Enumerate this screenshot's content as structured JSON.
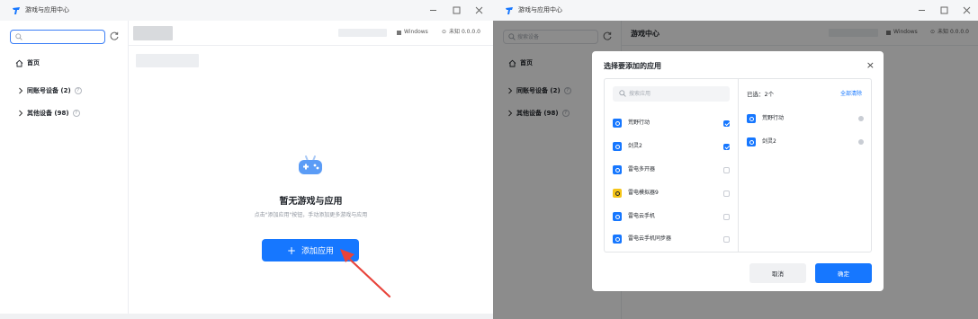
{
  "colors": {
    "accent": "#1677ff",
    "checkbox_checked": "#1677ff",
    "mask": "rgba(0,0,0,0.45)"
  },
  "window1": {
    "app_title": "游戏与应用中心",
    "search_placeholder": "",
    "nav": {
      "home": "首页",
      "same_account": "同账号设备 (2)",
      "other_devices": "其他设备 (98)"
    },
    "platform": "Windows",
    "location_version": "未知 0.0.0.0",
    "empty": {
      "title": "暂无游戏与应用",
      "subtitle": "点击\"添加应用\"按钮，手动添加更多游戏与应用"
    },
    "add_button": "添加应用"
  },
  "window2": {
    "app_title": "游戏与应用中心",
    "search_placeholder": "搜索设备",
    "page_title": "游戏中心",
    "platform": "Windows",
    "location_version": "未知 0.0.0.0",
    "nav": {
      "home": "首页",
      "same_account": "同账号设备 (2)",
      "other_devices": "其他设备 (98)"
    },
    "dialog": {
      "title": "选择要添加的应用",
      "search_placeholder": "搜索应用",
      "apps": [
        {
          "name": "荒野行动",
          "checked": true,
          "icon": "app-icon"
        },
        {
          "name": "剑灵2",
          "checked": true,
          "icon": "app-icon"
        },
        {
          "name": "雷电多开器",
          "checked": false,
          "icon": "app-icon"
        },
        {
          "name": "雷电模拟器9",
          "checked": false,
          "icon": "ldplayer-icon"
        },
        {
          "name": "雷电云手机",
          "checked": false,
          "icon": "app-icon"
        },
        {
          "name": "雷电云手机同步器",
          "checked": false,
          "icon": "app-icon"
        }
      ],
      "selected_label": "已选：2个",
      "clear_all": "全部清除",
      "selected": [
        {
          "name": "荒野行动"
        },
        {
          "name": "剑灵2"
        }
      ],
      "cancel": "取消",
      "confirm": "确定"
    }
  }
}
